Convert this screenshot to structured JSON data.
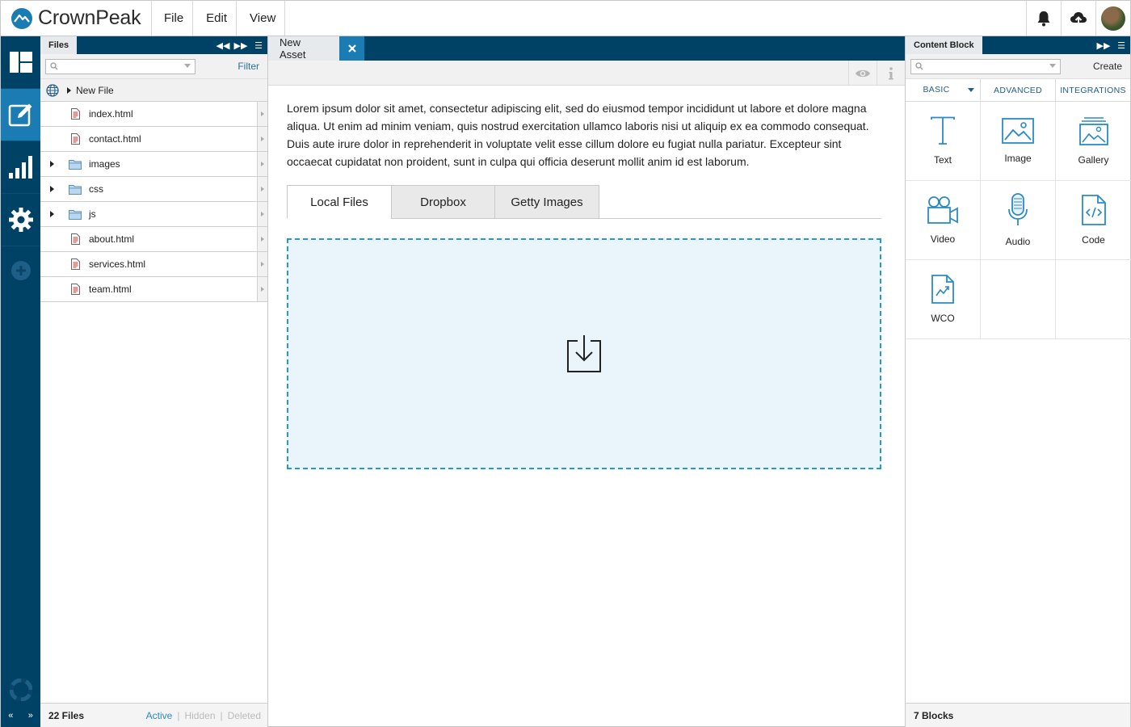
{
  "app": {
    "brand": "CrownPeak",
    "menus": [
      "File",
      "Edit",
      "View"
    ]
  },
  "topbar_icons": [
    "bell-icon",
    "cloud-upload-icon",
    "user-avatar"
  ],
  "rail": {
    "items": [
      {
        "name": "dashboard",
        "icon": "dashboard-icon",
        "active": false
      },
      {
        "name": "edit",
        "icon": "edit-icon",
        "active": true
      },
      {
        "name": "reports",
        "icon": "bar-chart-icon",
        "active": false
      },
      {
        "name": "settings",
        "icon": "gear-icon",
        "active": false
      }
    ],
    "add_icon": "plus-circle-icon",
    "help_icon": "lifebuoy-icon",
    "collapse_left": "«",
    "collapse_right": "»"
  },
  "files_panel": {
    "title": "Files",
    "search_placeholder": "",
    "filter_label": "Filter",
    "new_file_label": "New File",
    "items": [
      {
        "name": "index.html",
        "type": "file"
      },
      {
        "name": "contact.html",
        "type": "file"
      },
      {
        "name": "images",
        "type": "folder"
      },
      {
        "name": "css",
        "type": "folder"
      },
      {
        "name": "js",
        "type": "folder"
      },
      {
        "name": "about.html",
        "type": "file"
      },
      {
        "name": "services.html",
        "type": "file"
      },
      {
        "name": "team.html",
        "type": "file"
      }
    ],
    "footer": {
      "count": "22 Files",
      "views": [
        "Active",
        "Hidden",
        "Deleted"
      ],
      "active_view": "Active"
    }
  },
  "editor": {
    "tab_label": "New Asset",
    "body_text": "Lorem ipsum dolor sit amet, consectetur adipiscing elit, sed do eiusmod tempor incididunt ut labore et dolore magna aliqua. Ut enim ad minim veniam, quis nostrud exercitation ullamco laboris nisi ut aliquip ex ea commodo consequat. Duis aute irure dolor in reprehenderit in voluptate velit esse cillum dolore eu fugiat nulla pariatur. Excepteur sint occaecat cupidatat non proident, sunt in culpa qui officia deserunt mollit anim id est laborum.",
    "source_tabs": [
      "Local Files",
      "Dropbox",
      "Getty Images"
    ],
    "active_source_tab": "Local Files",
    "dropzone_icon": "download-tray-icon"
  },
  "content_block": {
    "title": "Content Block",
    "create_label": "Create",
    "search_placeholder": "",
    "categories": [
      "BASIC",
      "ADVANCED",
      "INTEGRATIONS"
    ],
    "active_category": "BASIC",
    "blocks": [
      {
        "label": "Text",
        "icon": "text-icon"
      },
      {
        "label": "Image",
        "icon": "image-icon"
      },
      {
        "label": "Gallery",
        "icon": "gallery-icon"
      },
      {
        "label": "Video",
        "icon": "video-camera-icon"
      },
      {
        "label": "Audio",
        "icon": "microphone-icon"
      },
      {
        "label": "Code",
        "icon": "code-file-icon"
      },
      {
        "label": "WCO",
        "icon": "chart-file-icon"
      }
    ],
    "footer_count": "7 Blocks"
  },
  "colors": {
    "navy": "#004265",
    "accent_blue": "#1b7bb3",
    "link_blue": "#2a8ac5",
    "icon_blue": "#2a8ac5",
    "dropzone_border": "#2796d4",
    "dropzone_fill": "#eaf4fb"
  }
}
